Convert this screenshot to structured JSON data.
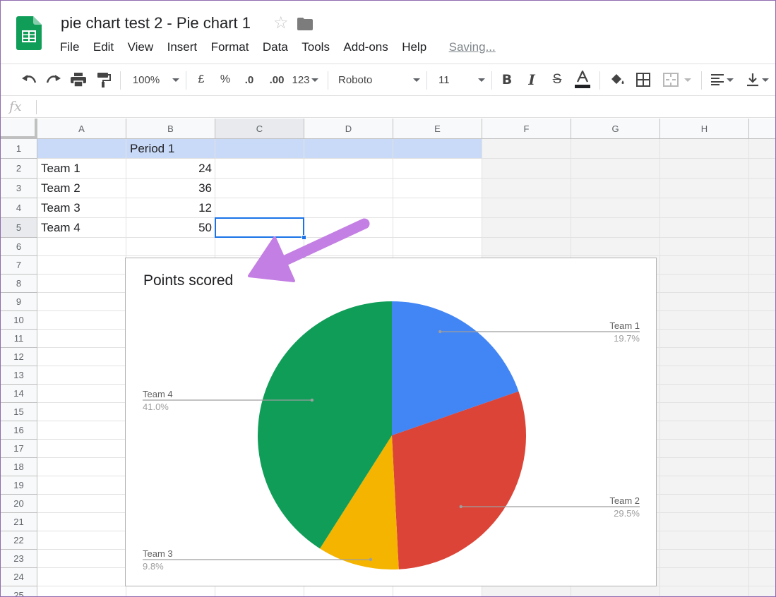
{
  "app": {
    "doc_title": "pie chart test 2 - Pie chart 1",
    "icons": [
      "sheets-logo-icon",
      "star-icon",
      "folder-icon"
    ],
    "menu": [
      "File",
      "Edit",
      "View",
      "Insert",
      "Format",
      "Data",
      "Tools",
      "Add-ons",
      "Help"
    ],
    "saving_status": "Saving..."
  },
  "toolbar": {
    "zoom": "100%",
    "currency": "£",
    "percent": "%",
    "decimal_decrease": ".0",
    "decimal_increase": ".00",
    "more_formats": "123",
    "font": "Roboto",
    "font_size": "11",
    "icons": [
      "undo-icon",
      "redo-icon",
      "print-icon",
      "paint-format-icon",
      "bold-icon",
      "italic-icon",
      "strikethrough-icon",
      "text-color-icon",
      "fill-color-icon",
      "borders-icon",
      "merge-cells-icon",
      "align-left-icon",
      "valign-bottom-icon"
    ],
    "accent_color": "#202124"
  },
  "formula_bar": {
    "label": "fx",
    "value": ""
  },
  "sheet": {
    "columns": [
      "A",
      "B",
      "C",
      "D",
      "E",
      "F",
      "G",
      "H"
    ],
    "rows": [
      "1",
      "2",
      "3",
      "4",
      "5",
      "6",
      "7",
      "8",
      "9",
      "10",
      "11",
      "12",
      "13",
      "14",
      "15",
      "16",
      "17",
      "18",
      "19",
      "20",
      "21",
      "22",
      "23",
      "24",
      "25"
    ],
    "cells": {
      "B1": "Period 1",
      "A2": "Team 1",
      "B2": "24",
      "A3": "Team 2",
      "B3": "36",
      "A4": "Team 3",
      "B4": "12",
      "A5": "Team 4",
      "B5": "50"
    },
    "selected_cell": "C5",
    "header_fill_color": "#c9daf8",
    "selection_color": "#1a73e8"
  },
  "annotation": {
    "arrow_color": "#c37fe3"
  },
  "chart_data": {
    "type": "pie",
    "title": "Points scored",
    "categories": [
      "Team 1",
      "Team 2",
      "Team 3",
      "Team 4"
    ],
    "values": [
      24,
      36,
      12,
      50
    ],
    "percent_labels": [
      "19.7%",
      "29.5%",
      "9.8%",
      "41.0%"
    ],
    "colors": [
      "#4285f4",
      "#db4437",
      "#f4b400",
      "#0f9d58"
    ],
    "legend": "labeled"
  }
}
